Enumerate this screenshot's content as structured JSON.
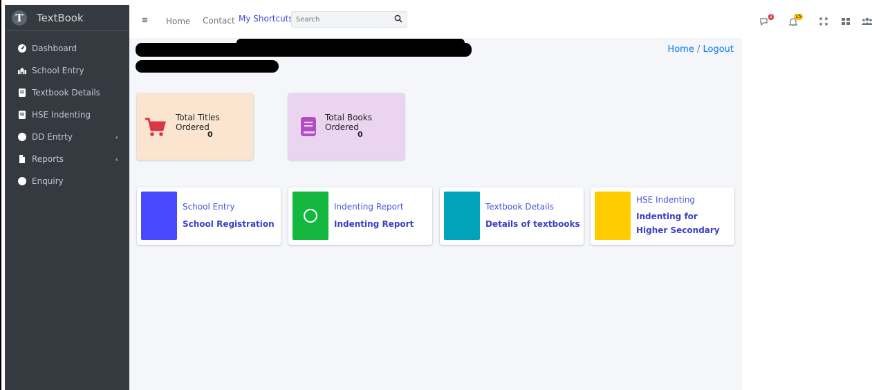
{
  "brand": {
    "name": "TextBook",
    "logo_letter": "T"
  },
  "sidebar": {
    "items": [
      {
        "label": "Dashboard",
        "icon": "tachometer-icon"
      },
      {
        "label": "School Entry",
        "icon": "school-icon"
      },
      {
        "label": "Textbook Details",
        "icon": "book-icon"
      },
      {
        "label": "HSE Indenting",
        "icon": "book-icon"
      },
      {
        "label": "DD Entrty",
        "icon": "circle-icon",
        "chevron": "‹"
      },
      {
        "label": "Reports",
        "icon": "file-icon",
        "chevron": "‹"
      },
      {
        "label": "Enquiry",
        "icon": "circle-icon"
      }
    ]
  },
  "topbar": {
    "menu_icon": "≡",
    "home": "Home",
    "contact": "Contact",
    "shortcuts": "My Shortcuts",
    "search_placeholder": "Search",
    "messages_badge": "3",
    "notifications_badge": "15"
  },
  "breadcrumb": {
    "home": "Home",
    "separator": "/",
    "logout": "Logout"
  },
  "stats": [
    {
      "label": "Total Titles Ordered",
      "value": "0",
      "bg": "#fbe5d0",
      "icon_color": "#dc3545",
      "icon": "cart-icon"
    },
    {
      "label": "Total Books Ordered",
      "value": "0",
      "bg": "#ead4ef",
      "icon_color": "#b44cc4",
      "icon": "book-icon"
    }
  ],
  "shortcuts": [
    {
      "title": "School Entry",
      "subtitle": "School Registration",
      "color": "#4848ff"
    },
    {
      "title": "Indenting Report",
      "subtitle": "Indenting Report",
      "color": "#14b83e",
      "icon": "circle-outline-icon"
    },
    {
      "title": "Textbook Details",
      "subtitle": "Details of textbooks",
      "color": "#00a3ba"
    },
    {
      "title": "HSE Indenting",
      "subtitle": "Indenting for Higher Secondary",
      "color": "#ffcc00"
    }
  ],
  "colors": {
    "sidebar_bg": "#343a40",
    "content_bg": "#f4f6f9",
    "link": "#007bff"
  }
}
